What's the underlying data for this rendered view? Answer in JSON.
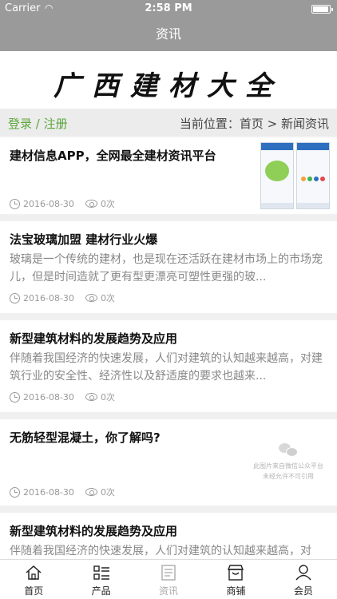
{
  "status_bar": {
    "carrier": "Carrier",
    "time": "2:58 PM"
  },
  "nav": {
    "title": "资讯"
  },
  "banner": {
    "logo_text": "广西建材大全"
  },
  "crumb_bar": {
    "login_label": "登录 / 注册",
    "location": "当前位置：首页 > 新闻资讯"
  },
  "articles": [
    {
      "title": "建材信息APP，全网最全建材资讯平台",
      "date": "2016-08-30",
      "views": "0次"
    },
    {
      "title": "法宝玻璃加盟 建材行业火爆",
      "desc": "玻璃是一个传统的建材，也是现在还活跃在建材市场上的市场宠儿，但是时间造就了更有型更漂亮可塑性更强的玻...",
      "date": "2016-08-30",
      "views": "0次"
    },
    {
      "title": "新型建筑材料的发展趋势及应用",
      "desc": "伴随着我国经济的快速发展，人们对建筑的认知越来越高，对建筑行业的安全性、经济性以及舒适度的要求也越来...",
      "date": "2016-08-30",
      "views": "0次"
    },
    {
      "title": "无筋轻型混凝土，你了解吗?",
      "watermark_line1": "此图片来自微信公众平台",
      "watermark_line2": "未经允许不可引用",
      "date": "2016-08-30",
      "views": "0次"
    },
    {
      "title": "新型建筑材料的发展趋势及应用",
      "desc": "伴随着我国经济的快速发展，人们对建筑的认知越来越高，对"
    }
  ],
  "tabs": [
    {
      "label": "首页",
      "icon": "home-icon"
    },
    {
      "label": "产品",
      "icon": "list-icon"
    },
    {
      "label": "资讯",
      "icon": "news-icon"
    },
    {
      "label": "商铺",
      "icon": "shop-icon"
    },
    {
      "label": "会员",
      "icon": "user-icon"
    }
  ],
  "colors": {
    "nav_bg": "#9a9a9a",
    "login_green": "#5ca63c",
    "inactive_tab": "#aaaaaa"
  }
}
